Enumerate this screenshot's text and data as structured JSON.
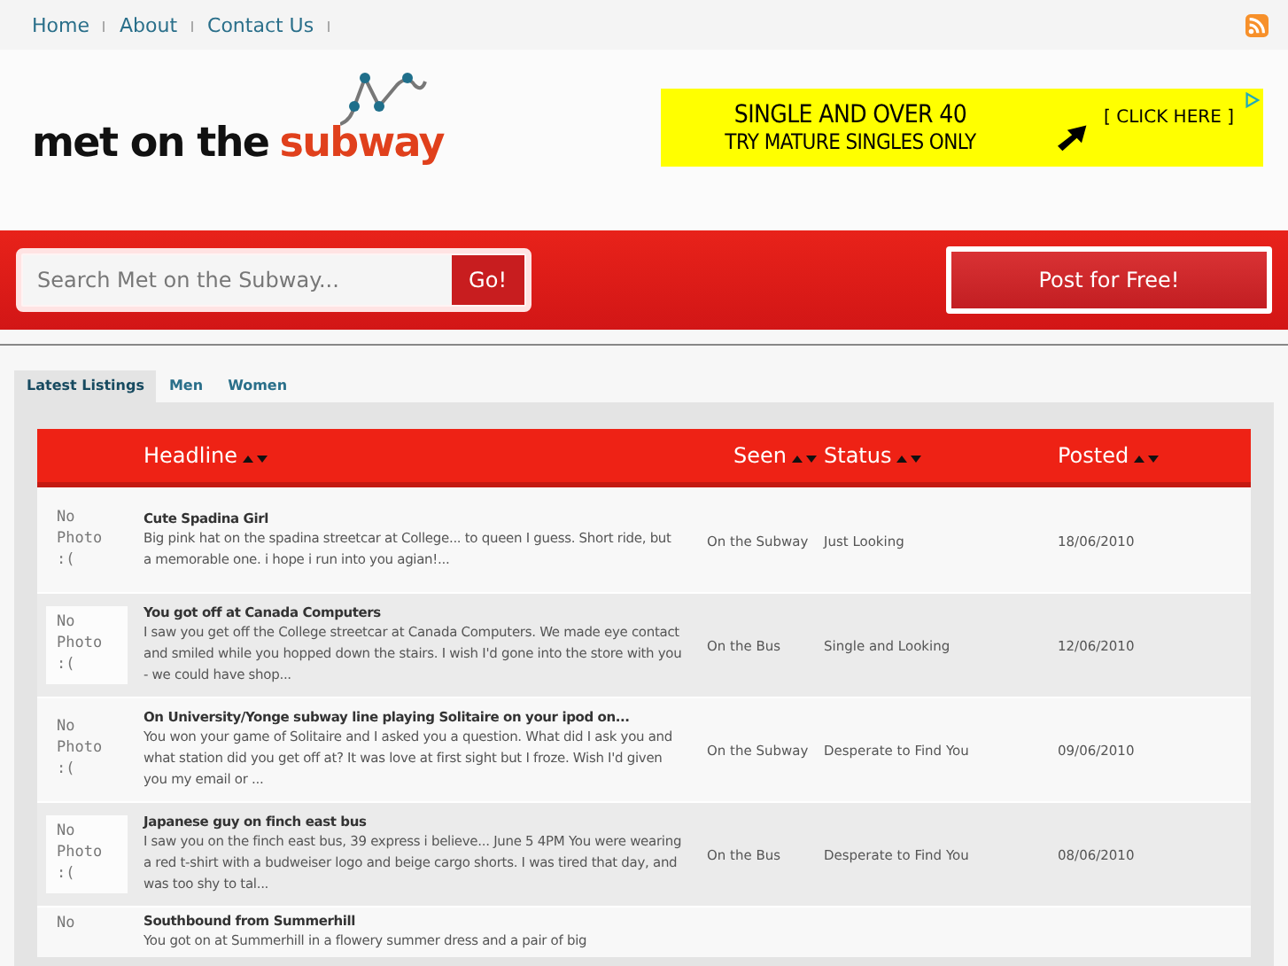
{
  "nav": {
    "links": [
      "Home",
      "About",
      "Contact Us"
    ]
  },
  "logo": {
    "text": "met on the",
    "highlight": "subway"
  },
  "ad": {
    "line_1": "SINGLE AND OVER 40",
    "line_2": "TRY MATURE SINGLES ONLY",
    "cta": "[ CLICK HERE ]"
  },
  "search": {
    "placeholder": "Search Met on the Subway...",
    "button": "Go!"
  },
  "post_button": "Post for Free!",
  "tabs": [
    {
      "label": "Latest Listings",
      "selected": true
    },
    {
      "label": "Men",
      "selected": false
    },
    {
      "label": "Women",
      "selected": false
    }
  ],
  "table": {
    "columns": [
      "Headline",
      "Seen",
      "Status",
      "Posted"
    ],
    "rows": [
      {
        "photo": "No Photo :(",
        "headline": "Cute Spadina Girl",
        "text": "Big pink hat on the spadina streetcar at College... to queen I guess. Short ride, but a memorable one. i hope i run into you agian!...",
        "seen": "On the Subway",
        "status": "Just Looking",
        "posted": "18/06/2010"
      },
      {
        "photo": "No Photo :(",
        "headline": "You got off at Canada Computers",
        "text": "I saw you get off the College streetcar at Canada Computers. We made eye contact and smiled while you hopped down the stairs. I wish I'd gone into the store with you - we could have shop...",
        "seen": "On the Bus",
        "status": "Single and Looking",
        "posted": "12/06/2010"
      },
      {
        "photo": "No Photo :(",
        "headline": "On University/Yonge subway line playing Solitaire on your ipod on...",
        "text": "You won your game of Solitaire and I asked you a question. What did I ask you and what station did you get off at? It was love at first sight but I froze. Wish I'd given you my email or ...",
        "seen": "On the Subway",
        "status": "Desperate to Find You",
        "posted": "09/06/2010"
      },
      {
        "photo": "No Photo :(",
        "headline": "Japanese guy on finch east bus",
        "text": "I saw you on the finch east bus, 39 express i believe... June 5 4PM You were wearing a red t-shirt with a budweiser logo and beige cargo shorts. I was tired that day, and was too shy to tal...",
        "seen": "On the Bus",
        "status": "Desperate to Find You",
        "posted": "08/06/2010"
      },
      {
        "photo": "No",
        "headline": "Southbound from Summerhill",
        "text": "You got on at Summerhill in a flowery summer dress and a pair of big"
      }
    ]
  }
}
